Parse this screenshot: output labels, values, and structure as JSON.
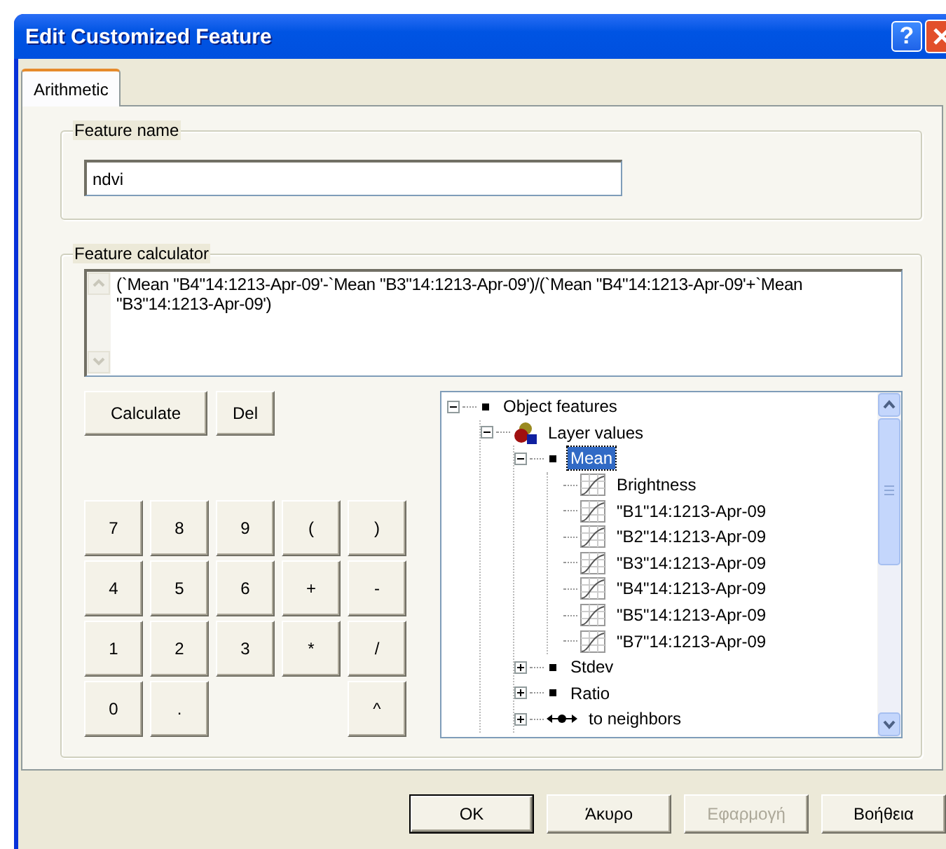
{
  "window": {
    "title": "Edit Customized Feature",
    "help_button": "?"
  },
  "tabs": [
    {
      "label": "Arithmetic",
      "selected": true
    }
  ],
  "feature_name": {
    "label": "Feature name",
    "value": "ndvi"
  },
  "feature_calculator": {
    "label": "Feature calculator",
    "formula": "(`Mean \"B4\"14:1213-Apr-09'-`Mean \"B3\"14:1213-Apr-09')/(`Mean \"B4\"14:1213-Apr-09'+`Mean \"B3\"14:1213-Apr-09')",
    "actions": [
      {
        "label": "Calculate"
      },
      {
        "label": "Del"
      }
    ],
    "keypad": [
      [
        {
          "kind": "key",
          "label": "7"
        },
        {
          "kind": "key",
          "label": "8"
        },
        {
          "kind": "key",
          "label": "9"
        },
        {
          "kind": "key",
          "label": "("
        },
        {
          "kind": "key",
          "label": ")"
        }
      ],
      [
        {
          "kind": "key",
          "label": "4"
        },
        {
          "kind": "key",
          "label": "5"
        },
        {
          "kind": "key",
          "label": "6"
        },
        {
          "kind": "key",
          "label": "+"
        },
        {
          "kind": "key",
          "label": "-"
        }
      ],
      [
        {
          "kind": "key",
          "label": "1"
        },
        {
          "kind": "key",
          "label": "2"
        },
        {
          "kind": "key",
          "label": "3"
        },
        {
          "kind": "key",
          "label": "*"
        },
        {
          "kind": "key",
          "label": "/"
        }
      ],
      [
        {
          "kind": "key",
          "label": "0"
        },
        {
          "kind": "key",
          "label": "."
        },
        {
          "kind": "gap"
        },
        {
          "kind": "gap"
        },
        {
          "kind": "key",
          "label": "^"
        }
      ]
    ],
    "tree": [
      {
        "label": "Object features",
        "kind": "bullet",
        "expanded": true,
        "selected": false,
        "children": [
          {
            "label": "Layer values",
            "kind": "layers",
            "expanded": true,
            "selected": false,
            "children": [
              {
                "label": "Mean",
                "kind": "bullet",
                "expanded": true,
                "selected": true,
                "children": [
                  {
                    "label": "Brightness",
                    "kind": "chart",
                    "selected": false
                  },
                  {
                    "label": "\"B1\"14:1213-Apr-09",
                    "kind": "chart",
                    "selected": false
                  },
                  {
                    "label": "\"B2\"14:1213-Apr-09",
                    "kind": "chart",
                    "selected": false
                  },
                  {
                    "label": "\"B3\"14:1213-Apr-09",
                    "kind": "chart",
                    "selected": false
                  },
                  {
                    "label": "\"B4\"14:1213-Apr-09",
                    "kind": "chart",
                    "selected": false
                  },
                  {
                    "label": "\"B5\"14:1213-Apr-09",
                    "kind": "chart",
                    "selected": false
                  },
                  {
                    "label": "\"B7\"14:1213-Apr-09",
                    "kind": "chart",
                    "selected": false
                  }
                ]
              },
              {
                "label": "Stdev",
                "kind": "bullet",
                "expanded": false,
                "selected": false
              },
              {
                "label": "Ratio",
                "kind": "bullet",
                "expanded": false,
                "selected": false
              },
              {
                "label": "to neighbors",
                "kind": "link",
                "expanded": false,
                "selected": false
              }
            ]
          }
        ]
      }
    ]
  },
  "buttons": [
    {
      "label": "OK",
      "default": true,
      "disabled": false
    },
    {
      "label": "Άκυρο",
      "default": false,
      "disabled": false
    },
    {
      "label": "Εφαρμογή",
      "default": false,
      "disabled": true
    },
    {
      "label": "Βοήθεια",
      "default": false,
      "disabled": false
    }
  ]
}
